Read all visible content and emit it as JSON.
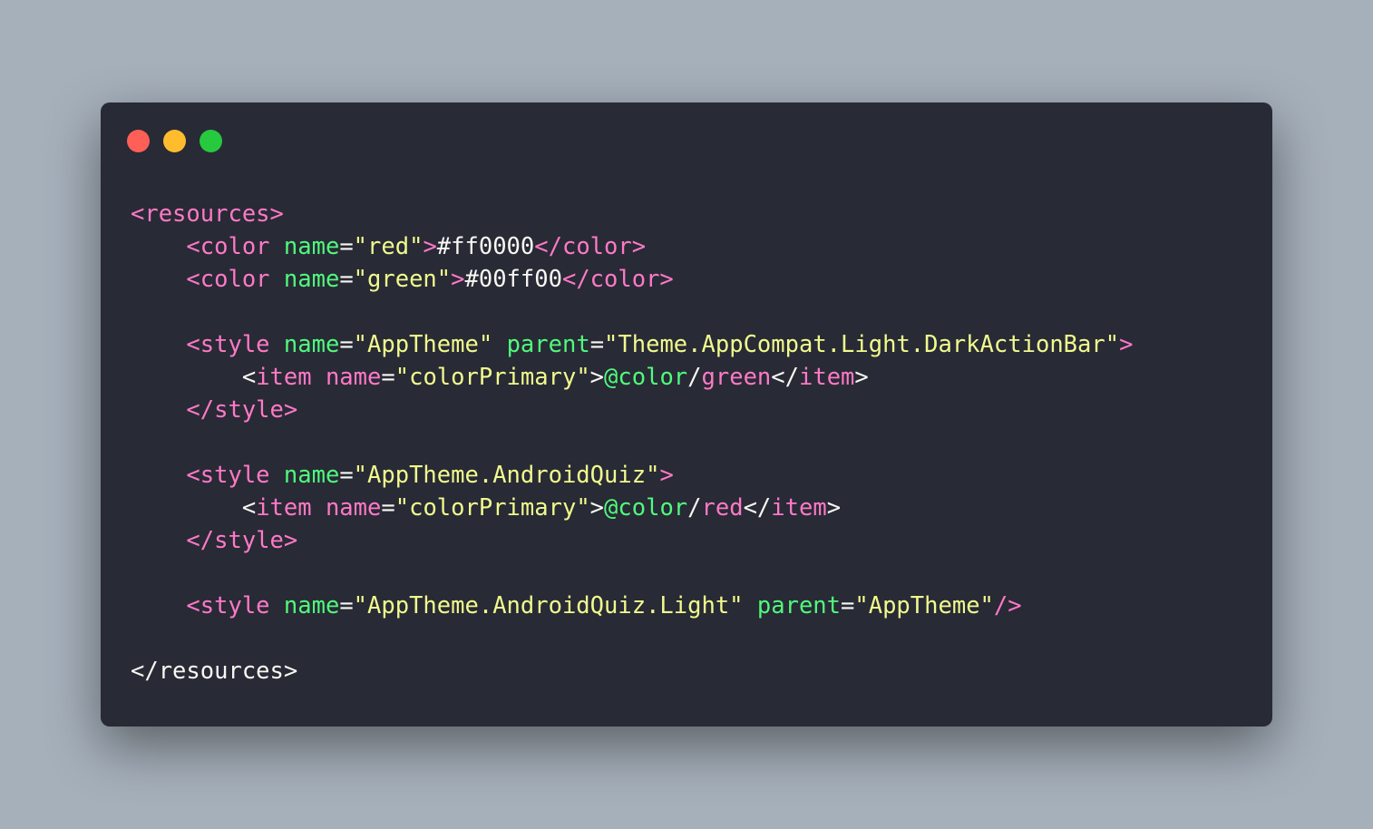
{
  "window": {
    "controls": [
      {
        "name": "close",
        "color": "#ff5f56"
      },
      {
        "name": "minimize",
        "color": "#ffbd2e"
      },
      {
        "name": "maximize",
        "color": "#27c93f"
      }
    ]
  },
  "colors": {
    "background": "#a6b0bb",
    "editor_bg": "#282a36",
    "tag": "#ff79c6",
    "attr": "#50fa7b",
    "string": "#f1fa8c",
    "text": "#f8f8f2"
  },
  "code": {
    "language": "xml",
    "lines": [
      [
        [
          "tag",
          "<resources>"
        ]
      ],
      [
        [
          "text",
          "    "
        ],
        [
          "tag",
          "<color "
        ],
        [
          "attr",
          "name"
        ],
        [
          "punct",
          "="
        ],
        [
          "str",
          "\"red\""
        ],
        [
          "tag",
          ">"
        ],
        [
          "text",
          "#ff0000"
        ],
        [
          "tag",
          "</color>"
        ]
      ],
      [
        [
          "text",
          "    "
        ],
        [
          "tag",
          "<color "
        ],
        [
          "attr",
          "name"
        ],
        [
          "punct",
          "="
        ],
        [
          "str",
          "\"green\""
        ],
        [
          "tag",
          ">"
        ],
        [
          "text",
          "#00ff00"
        ],
        [
          "tag",
          "</color>"
        ]
      ],
      [],
      [
        [
          "text",
          "    "
        ],
        [
          "tag",
          "<style "
        ],
        [
          "attr",
          "name"
        ],
        [
          "punct",
          "="
        ],
        [
          "str",
          "\"AppTheme\" "
        ],
        [
          "attr",
          "parent"
        ],
        [
          "punct",
          "="
        ],
        [
          "str",
          "\"Theme.AppCompat.Light.DarkActionBar\""
        ],
        [
          "tag",
          ">"
        ]
      ],
      [
        [
          "text",
          "        "
        ],
        [
          "punct",
          "<"
        ],
        [
          "tag",
          "item "
        ],
        [
          "tag",
          "name"
        ],
        [
          "punct",
          "="
        ],
        [
          "str",
          "\"colorPrimary\""
        ],
        [
          "punct",
          ">"
        ],
        [
          "attr",
          "@color"
        ],
        [
          "punct",
          "/"
        ],
        [
          "tag",
          "green"
        ],
        [
          "punct",
          "</"
        ],
        [
          "tag",
          "item"
        ],
        [
          "punct",
          ">"
        ]
      ],
      [
        [
          "text",
          "    "
        ],
        [
          "tag",
          "</style>"
        ]
      ],
      [],
      [
        [
          "text",
          "    "
        ],
        [
          "tag",
          "<style "
        ],
        [
          "attr",
          "name"
        ],
        [
          "punct",
          "="
        ],
        [
          "str",
          "\"AppTheme.AndroidQuiz\""
        ],
        [
          "tag",
          ">"
        ]
      ],
      [
        [
          "text",
          "        "
        ],
        [
          "punct",
          "<"
        ],
        [
          "tag",
          "item "
        ],
        [
          "tag",
          "name"
        ],
        [
          "punct",
          "="
        ],
        [
          "str",
          "\"colorPrimary\""
        ],
        [
          "punct",
          ">"
        ],
        [
          "attr",
          "@color"
        ],
        [
          "punct",
          "/"
        ],
        [
          "tag",
          "red"
        ],
        [
          "punct",
          "</"
        ],
        [
          "tag",
          "item"
        ],
        [
          "punct",
          ">"
        ]
      ],
      [
        [
          "text",
          "    "
        ],
        [
          "tag",
          "</style>"
        ]
      ],
      [],
      [
        [
          "text",
          "    "
        ],
        [
          "tag",
          "<style "
        ],
        [
          "attr",
          "name"
        ],
        [
          "punct",
          "="
        ],
        [
          "str",
          "\"AppTheme.AndroidQuiz.Light\" "
        ],
        [
          "attr",
          "parent"
        ],
        [
          "punct",
          "="
        ],
        [
          "str",
          "\"AppTheme\""
        ],
        [
          "tag",
          "/>"
        ]
      ],
      [],
      [
        [
          "punct",
          "</resources>"
        ]
      ]
    ]
  }
}
